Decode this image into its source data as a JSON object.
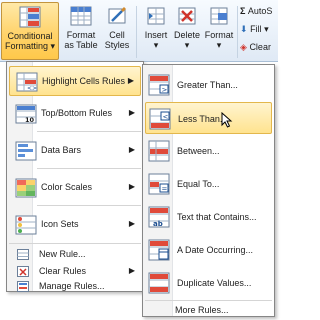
{
  "ribbon": {
    "conditional_formatting": "Conditional Formatting",
    "conditional_formatting_l1": "Conditional",
    "conditional_formatting_l2": "Formatting",
    "format_as_table_l1": "Format",
    "format_as_table_l2": "as Table",
    "cell_styles_l1": "Cell",
    "cell_styles_l2": "Styles",
    "insert": "Insert",
    "delete": "Delete",
    "format": "Format",
    "autosum": "AutoS",
    "fill": "Fill",
    "clear": "Clear"
  },
  "menu": {
    "items": [
      {
        "label": "Highlight Cells Rules",
        "icon": "highlight-cells-icon"
      },
      {
        "label": "Top/Bottom Rules",
        "icon": "top-bottom-icon"
      },
      {
        "label": "Data Bars",
        "icon": "data-bars-icon"
      },
      {
        "label": "Color Scales",
        "icon": "color-scales-icon"
      },
      {
        "label": "Icon Sets",
        "icon": "icon-sets-icon"
      }
    ],
    "small_items": [
      {
        "label": "New Rule..."
      },
      {
        "label": "Clear Rules"
      },
      {
        "label": "Manage Rules..."
      }
    ]
  },
  "submenu": {
    "items": [
      {
        "label": "Greater Than..."
      },
      {
        "label": "Less Than..."
      },
      {
        "label": "Between..."
      },
      {
        "label": "Equal To..."
      },
      {
        "label": "Text that Contains..."
      },
      {
        "label": "A Date Occurring..."
      },
      {
        "label": "Duplicate Values..."
      }
    ],
    "more_rules": "More Rules..."
  },
  "colors": {
    "highlight": "#ffe38f",
    "highlight_border": "#e3b74c",
    "ribbon_bg": "#dfe9f5",
    "accent_blue": "#2f6fb8"
  }
}
